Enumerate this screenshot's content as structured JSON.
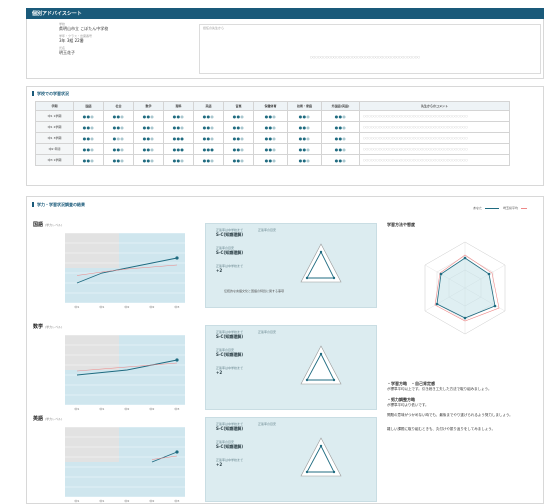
{
  "header": {
    "title": "個別アドバイスシート"
  },
  "info": {
    "school_label": "学校",
    "school": "県明山市立 こぼたん中学校",
    "class_label": "学年・クラス・出席番号",
    "class": "3年 3組 22番",
    "name_label": "氏名",
    "name": "明玉花子",
    "comment_label": "担任の先生から",
    "comment_placeholder": "○○○○○○○○○○○○○○○○○○○○○○○○○○○○○○○○○○○○○○○○○○"
  },
  "subjects_section": {
    "title": "学校での学習状況",
    "headers": [
      "学期",
      "国語",
      "社会",
      "数学",
      "理科",
      "英語",
      "音楽",
      "保健体育",
      "技術・家庭",
      "外国語(英語)",
      "先生からのコメント"
    ],
    "rows": [
      {
        "term": "中1 1学期",
        "ratings": [
          2,
          2,
          2,
          2,
          2,
          2,
          2,
          2,
          2
        ],
        "comment": "○○○○○○○○○○○○○○○○○○○○○○○○○○○○○○○○○○○○○○○○"
      },
      {
        "term": "中1 2学期",
        "ratings": [
          2,
          2,
          2,
          2,
          2,
          2,
          2,
          2,
          2
        ],
        "comment": "○○○○○○○○○○○○○○○○○○○○○○○○○○○○○○○○○○○○○○○○"
      },
      {
        "term": "中1 3学期",
        "ratings": [
          2,
          1,
          2,
          3,
          2,
          2,
          2,
          2,
          2
        ],
        "comment": "○○○○○○○○○○○○○○○○○○○○○○○○○○○○○○○○○○○○○○○○"
      },
      {
        "term": "中2 年間",
        "ratings": [
          2,
          2,
          2,
          3,
          3,
          2,
          2,
          2,
          2
        ],
        "comment": "○○○○○○○○○○○○○○○○○○○○○○○○○○○○○○○○○○○○○○○○"
      },
      {
        "term": "中3 1学期",
        "ratings": [
          2,
          2,
          2,
          2,
          2,
          2,
          2,
          2,
          2
        ],
        "comment": "○○○○○○○○○○○○○○○○○○○○○○○○○○○○○○○○○○○○○○○○"
      }
    ]
  },
  "results_section": {
    "title": "学力・学習状況調査の結果",
    "subjects": [
      {
        "name": "国語",
        "unit": "(学力レベル)",
        "panel": {
          "h1": "正答率は中学校まで",
          "h2": "正答率の目安",
          "v1": "S-C(知識理解)",
          "v2": "S-C(知識理解)",
          "v3": "+2",
          "note": "伝統的な言語文化と国語の特質に関する事項"
        }
      },
      {
        "name": "数学",
        "unit": "(学力レベル)",
        "panel": {
          "h1": "正答率は中学校まで",
          "h2": "正答率の目安",
          "v1": "S-C(知識理解)",
          "v2": "S-C(知識理解)",
          "v3": "+2",
          "note": ""
        }
      },
      {
        "name": "英語",
        "unit": "(学力レベル)",
        "panel": {
          "h1": "正答率は中学校まで",
          "h2": "正答率の目安",
          "v1": "S-C(知識理解)",
          "v2": "S-C(知識理解)",
          "v3": "+2",
          "note": ""
        }
      }
    ],
    "legend": {
      "you": "あなた",
      "avg": "埼玉県平均"
    },
    "study_title": "学習方法や態度",
    "advice": [
      {
        "heading": "・学習方略　・自己肯定感",
        "body": "が標準平均以上です。引き続き工夫した方法で取り組みましょう。"
      },
      {
        "heading": "・努力調整方略",
        "body": "が標準平均より低いです。"
      },
      {
        "heading": "",
        "body": "問題の意味がつかめない時でも、最後までやり遂げられるよう努力しましょう。"
      },
      {
        "heading": "",
        "body": "難しい課題に取り組むときも、丸付けや振り返りをしてみましょう。"
      }
    ]
  },
  "chart_data": [
    {
      "type": "line",
      "x": [
        "中1",
        "中1",
        "中2",
        "中2",
        "中3"
      ],
      "series": [
        {
          "name": "あなた",
          "values": [
            4,
            6,
            7,
            8,
            9
          ]
        },
        {
          "name": "埼玉県平均",
          "values": [
            5.5,
            6.2,
            6.8,
            7.2,
            7.6
          ]
        }
      ],
      "ylim": [
        0,
        14
      ]
    },
    {
      "type": "line",
      "x": [
        "中1",
        "中1",
        "中2",
        "中2",
        "中3"
      ],
      "series": [
        {
          "name": "あなた",
          "values": [
            6,
            6.5,
            7,
            8,
            9
          ]
        },
        {
          "name": "埼玉県平均",
          "values": [
            6.8,
            7.2,
            7.6,
            8.0,
            8.4
          ]
        }
      ],
      "ylim": [
        0,
        14
      ]
    },
    {
      "type": "line",
      "x": [
        "中1",
        "中1",
        "中2",
        "中2",
        "中3"
      ],
      "series": [
        {
          "name": "あなた",
          "values": [
            null,
            null,
            null,
            7,
            9
          ]
        },
        {
          "name": "埼玉県平均",
          "values": [
            null,
            null,
            null,
            7.5,
            8.2
          ]
        }
      ],
      "ylim": [
        0,
        14
      ]
    }
  ]
}
